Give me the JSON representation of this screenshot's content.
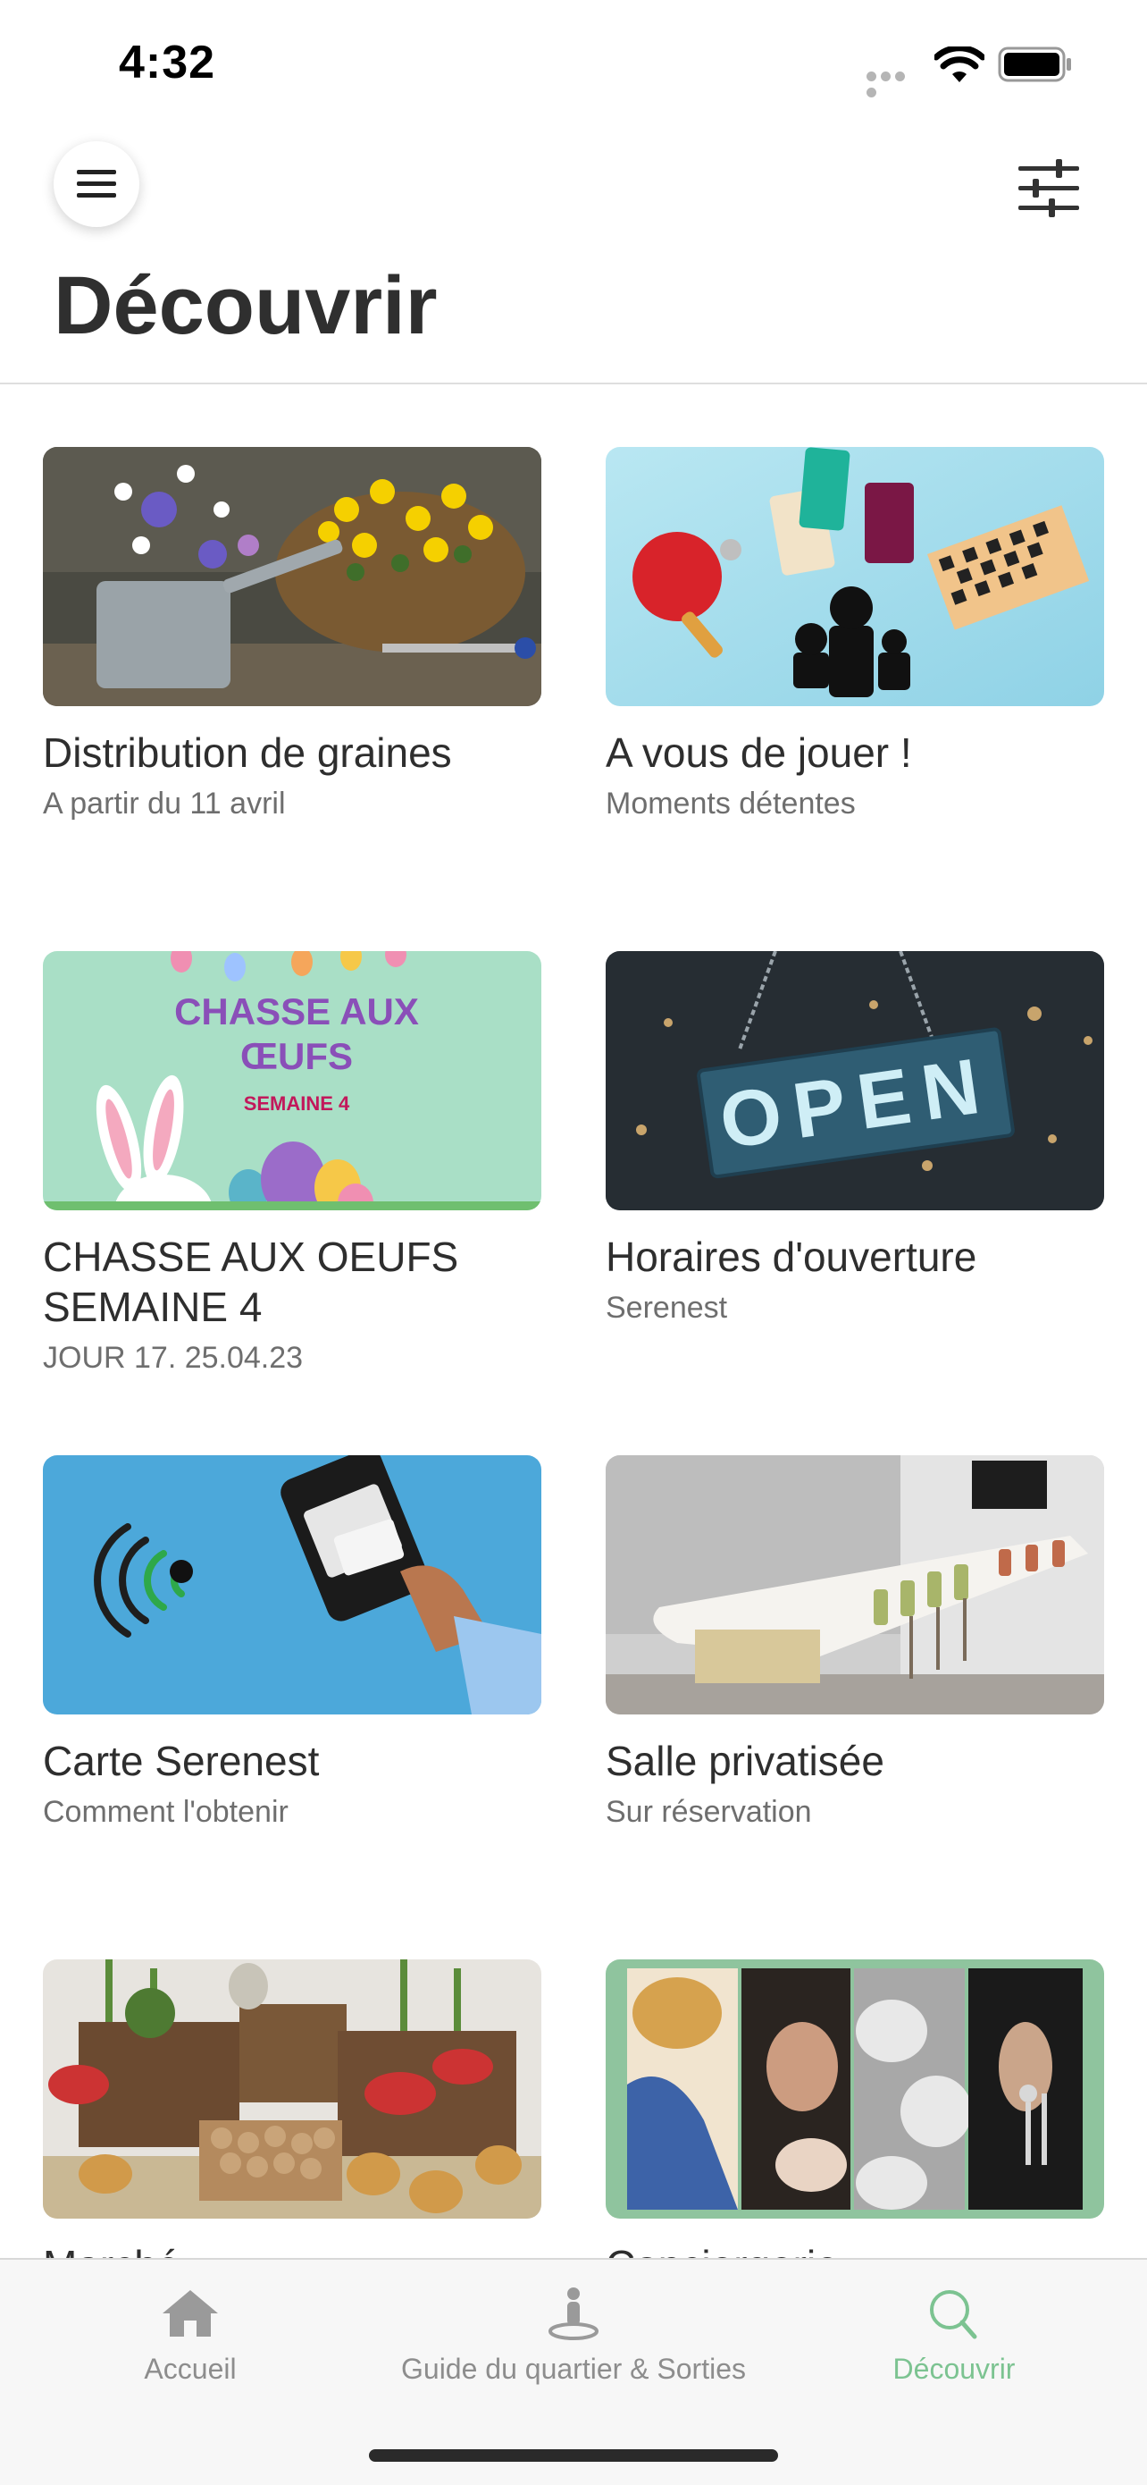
{
  "status_bar": {
    "time": "4:32"
  },
  "header": {
    "title": "Découvrir"
  },
  "cards": [
    {
      "title": "Distribution de graines",
      "subtitle": "A partir du 11 avril",
      "image": "watering-can-flowers-image"
    },
    {
      "title": "A vous de jouer !",
      "subtitle": "Moments détentes",
      "image": "games-image"
    },
    {
      "title": "CHASSE AUX OEUFS SEMAINE 4",
      "subtitle": "JOUR 17. 25.04.23",
      "image": "easter-egg-hunt-image",
      "image_text": {
        "line1": "CHASSE AUX",
        "line2": "ŒUFS",
        "line3": "SEMAINE 4"
      }
    },
    {
      "title": "Horaires d'ouverture",
      "subtitle": "Serenest",
      "image": "open-sign-image",
      "image_text": "OPEN"
    },
    {
      "title": "Carte Serenest",
      "subtitle": "Comment l'obtenir",
      "image": "card-payment-image"
    },
    {
      "title": "Salle privatisée",
      "subtitle": "Sur réservation",
      "image": "private-room-image"
    },
    {
      "title": "Marché",
      "subtitle": "",
      "image": "market-vegetables-image"
    },
    {
      "title": "Conciergerie",
      "subtitle": "",
      "image": "concierge-services-image"
    }
  ],
  "tab_bar": {
    "items": [
      {
        "label": "Accueil",
        "icon": "home-icon",
        "active": false
      },
      {
        "label": "Guide du quartier & Sorties",
        "icon": "location-person-icon",
        "active": false
      },
      {
        "label": "Découvrir",
        "icon": "search-icon",
        "active": true
      }
    ]
  },
  "colors": {
    "accent": "#7cc391",
    "text": "#2e2e2e",
    "muted": "#6e6e6e"
  }
}
